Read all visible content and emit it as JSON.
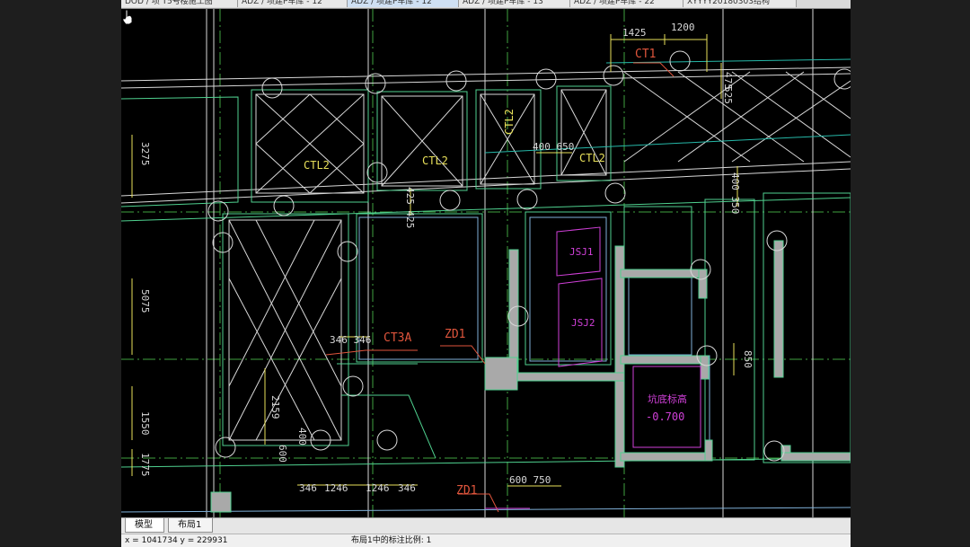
{
  "document_tabs": [
    {
      "label": "DOD / 项 T5号楼施工图"
    },
    {
      "label": "ADZ / 项建P车库 - 12"
    },
    {
      "label": "ADZ / 项建P车库 - 12",
      "active": true
    },
    {
      "label": "ADZ / 项建P车库 - 13"
    },
    {
      "label": "ADZ / 项建P车库 - 22"
    },
    {
      "label": "XYYYY20180303结构"
    }
  ],
  "drawing": {
    "labels": {
      "ctl2_a": "CTL2",
      "ctl2_b": "CTL2",
      "ctl2_c": "CTL2",
      "ctl2_d": "CTL2",
      "ct1": "CT1",
      "ct3a": "CT3A",
      "zd1_a": "ZD1",
      "zd1_b": "ZD1",
      "jsj1": "JSJ1",
      "jsj2": "JSJ2",
      "pit_title": "坑底标高",
      "pit_value": "-0.700"
    },
    "dimensions": {
      "d1425": "1425",
      "d1200": "1200",
      "d475": "475",
      "d525": "525",
      "d400_650": "400 650",
      "d425_425": "425 425",
      "d400_350": "400 350",
      "d3275": "3275",
      "d5075": "5075",
      "d1550": "1550",
      "d1775": "1775",
      "d346_346": "346 346",
      "d2159": "2159",
      "d600": "600",
      "d400": "400",
      "d850": "850",
      "d346": "346",
      "d1246": "1246",
      "d1246b": "1246",
      "d346b": "346",
      "d600_750": "600   750"
    }
  },
  "layout_tabs": [
    {
      "label": "模型",
      "active": true
    },
    {
      "label": "布局1",
      "active": false
    }
  ],
  "status": {
    "coords": "x = 1041734  y = 229931",
    "scale": "布局1中的标注比例: 1"
  },
  "colors": {
    "background": "#000000",
    "grid_white": "#e0e0e0",
    "wall_green": "#4fd18f",
    "axis_green": "#3fa23f",
    "dim_yellow": "#e8e05a",
    "text_red": "#e0553c",
    "outline_blue": "#7fb0d8",
    "magenta": "#d040d8",
    "wall_fill": "#a9a9a9",
    "teal": "#26b8a8"
  }
}
